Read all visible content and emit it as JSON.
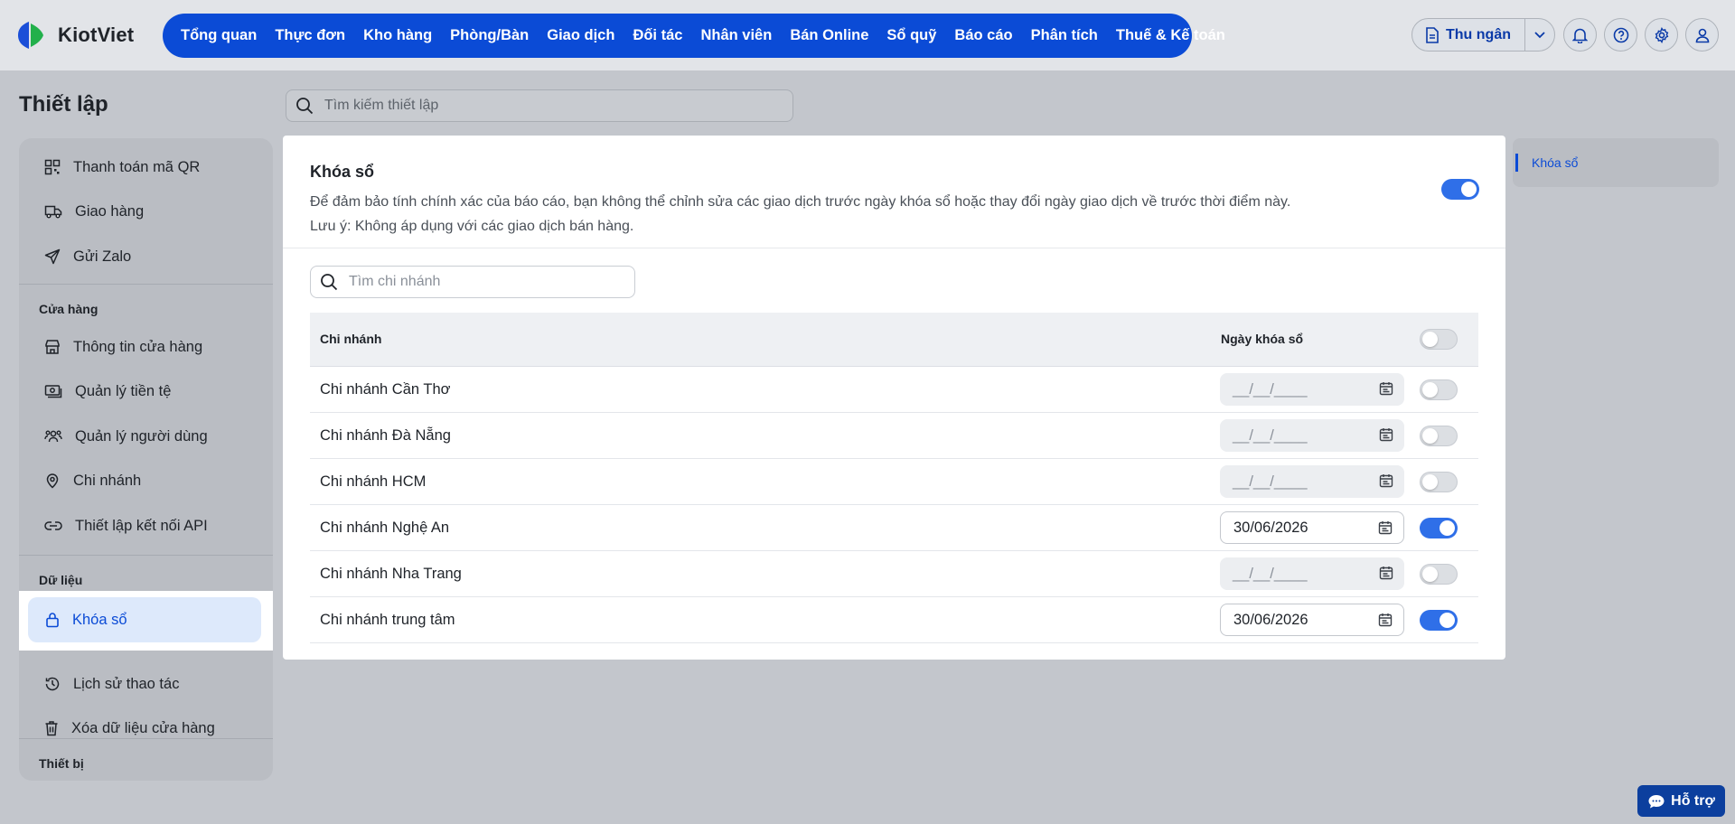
{
  "brand": {
    "name": "KiotViet"
  },
  "nav": {
    "items": [
      "Tổng quan",
      "Thực đơn",
      "Kho hàng",
      "Phòng/Bàn",
      "Giao dịch",
      "Đối tác",
      "Nhân viên",
      "Bán Online",
      "Sổ quỹ",
      "Báo cáo",
      "Phân tích",
      "Thuế & Kế toán"
    ]
  },
  "header": {
    "cashier_label": "Thu ngân",
    "icons": [
      "bell-icon",
      "help-icon",
      "gear-icon",
      "user-icon"
    ]
  },
  "page": {
    "title": "Thiết lập",
    "search_placeholder": "Tìm kiếm thiết lập"
  },
  "sidebar": {
    "top_items": [
      {
        "label": "Thanh toán mã QR",
        "icon": "qr-icon"
      },
      {
        "label": "Giao hàng",
        "icon": "truck-icon"
      },
      {
        "label": "Gửi Zalo",
        "icon": "send-icon"
      }
    ],
    "sections": [
      {
        "title": "Cửa hàng",
        "items": [
          {
            "label": "Thông tin cửa hàng",
            "icon": "store-icon"
          },
          {
            "label": "Quản lý tiền tệ",
            "icon": "money-icon"
          },
          {
            "label": "Quản lý người dùng",
            "icon": "users-icon"
          },
          {
            "label": "Chi nhánh",
            "icon": "map-pin-icon"
          },
          {
            "label": "Thiết lập kết nối API",
            "icon": "link-icon"
          }
        ]
      },
      {
        "title": "Dữ liệu",
        "items": [
          {
            "label": "Khóa sổ",
            "icon": "lock-icon",
            "active": true
          },
          {
            "label": "Lịch sử thao tác",
            "icon": "history-icon"
          },
          {
            "label": "Xóa dữ liệu cửa hàng",
            "icon": "trash-icon"
          }
        ]
      },
      {
        "title": "Thiết bị",
        "items": []
      }
    ]
  },
  "lock": {
    "title": "Khóa sổ",
    "description": "Để đảm bảo tính chính xác của báo cáo, bạn không thể chỉnh sửa các giao dịch trước ngày khóa sổ hoặc thay đổi ngày giao dịch về trước thời điểm này.",
    "note": "Lưu ý: Không áp dụng với các giao dịch bán hàng.",
    "enabled": true,
    "branch_search_placeholder": "Tìm chi nhánh",
    "columns": {
      "branch": "Chi nhánh",
      "date": "Ngày khóa sổ"
    },
    "header_toggle": false,
    "date_placeholder": "__/__/____",
    "rows": [
      {
        "name": "Chi nhánh Cần Thơ",
        "date": "",
        "enabled": false
      },
      {
        "name": "Chi nhánh Đà Nẵng",
        "date": "",
        "enabled": false
      },
      {
        "name": "Chi nhánh HCM",
        "date": "",
        "enabled": false
      },
      {
        "name": "Chi nhánh Nghệ An",
        "date": "30/06/2026",
        "enabled": true
      },
      {
        "name": "Chi nhánh Nha Trang",
        "date": "",
        "enabled": false
      },
      {
        "name": "Chi nhánh trung tâm",
        "date": "30/06/2026",
        "enabled": true
      }
    ]
  },
  "toc": {
    "items": [
      "Khóa sổ"
    ]
  },
  "support": {
    "label": "Hỗ trợ"
  },
  "colors": {
    "accent": "#0b4bd6",
    "toggle_on": "#2f6fe8",
    "active_bg": "#dde9fb"
  }
}
